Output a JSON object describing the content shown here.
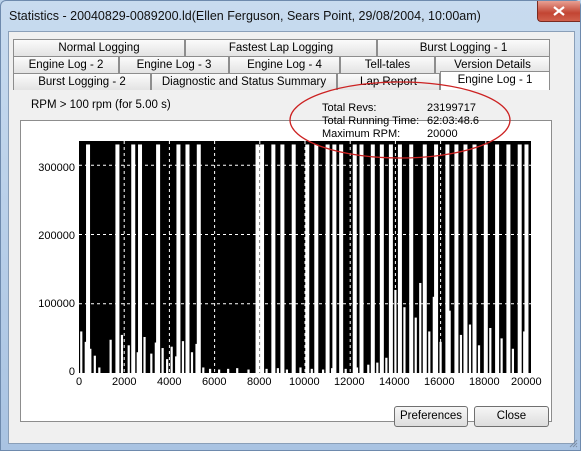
{
  "window": {
    "title": "Statistics - 20040829-0089200.ld(Ellen Ferguson, Sears Point, 29/08/2004, 10:00am)"
  },
  "tabs": {
    "row1": [
      "Normal Logging",
      "Fastest Lap Logging",
      "Burst Logging - 1"
    ],
    "row2": [
      "Engine Log - 2",
      "Engine Log - 3",
      "Engine Log - 4",
      "Tell-tales",
      "Version Details"
    ],
    "row3": [
      "Burst Logging - 2",
      "Diagnostic and Status Summary",
      "Lap Report",
      "Engine Log - 1"
    ],
    "active": "Engine Log - 1"
  },
  "panel": {
    "caption": "RPM > 100 rpm (for 5.00 s)",
    "stats": [
      {
        "label": "Total Revs:",
        "value": "23199717"
      },
      {
        "label": "Total Running Time:",
        "value": "62:03:48.6"
      },
      {
        "label": "Maximum RPM:",
        "value": "20000"
      }
    ]
  },
  "colors": {
    "plot_background": "#000000",
    "bars": "#ffffff",
    "annotation": "#cc2222"
  },
  "chart_data": {
    "type": "bar",
    "x_ticks": [
      "0",
      "2000",
      "4000",
      "6000",
      "8000",
      "10000",
      "12000",
      "14000",
      "16000",
      "18000",
      "20000"
    ],
    "y_ticks": [
      "0",
      "100000",
      "200000",
      "300000"
    ],
    "xlim": [
      0,
      20000
    ],
    "ylim": [
      0,
      335000
    ],
    "grid": "dashed white",
    "series": [
      {
        "x": [
          400,
          1700,
          2400,
          2700,
          3500,
          4400,
          4800,
          5300,
          7900,
          8100,
          8600,
          9000,
          9500,
          10100,
          10500,
          11000,
          11300,
          11600,
          12200,
          12500,
          13000,
          13400,
          13800,
          14200,
          14700,
          15300,
          15800,
          16300,
          16700,
          17100,
          17500,
          18000,
          18500,
          19000,
          19500,
          19800
        ],
        "values": [
          330000,
          330000,
          330000,
          330000,
          330000,
          330000,
          330000,
          330000,
          330000,
          330000,
          330000,
          330000,
          330000,
          330000,
          330000,
          330000,
          330000,
          330000,
          330000,
          330000,
          330000,
          330000,
          330000,
          330000,
          330000,
          330000,
          330000,
          330000,
          330000,
          330000,
          330000,
          330000,
          330000,
          330000,
          330000,
          330000
        ]
      },
      {
        "x": [
          100,
          300,
          500,
          700,
          900,
          1400,
          1900,
          2200,
          2600,
          2900,
          3200,
          3400,
          3700,
          3900,
          4100,
          4300,
          4600,
          5000,
          5200,
          5500,
          5800,
          6200,
          6600,
          7000,
          7500,
          8300,
          8800,
          9200,
          9800,
          10300,
          10800,
          11200,
          11800,
          12300,
          12800,
          13200,
          13600,
          14000,
          14400,
          14900,
          15100,
          15500,
          15700,
          16000,
          16400,
          16900,
          17300,
          17700,
          18200,
          18700,
          19200,
          19700
        ],
        "values": [
          60000,
          45000,
          35000,
          25000,
          8000,
          48000,
          55000,
          40000,
          30000,
          52000,
          28000,
          44000,
          36000,
          20000,
          38000,
          24000,
          46000,
          30000,
          42000,
          8000,
          6000,
          5000,
          6000,
          7000,
          5000,
          6000,
          7000,
          5000,
          8000,
          6000,
          5000,
          7000,
          6000,
          8000,
          12000,
          15000,
          22000,
          120000,
          95000,
          80000,
          130000,
          60000,
          110000,
          45000,
          90000,
          55000,
          70000,
          40000,
          65000,
          50000,
          35000,
          60000
        ]
      }
    ]
  },
  "buttons": {
    "preferences": "Preferences",
    "close": "Close"
  }
}
